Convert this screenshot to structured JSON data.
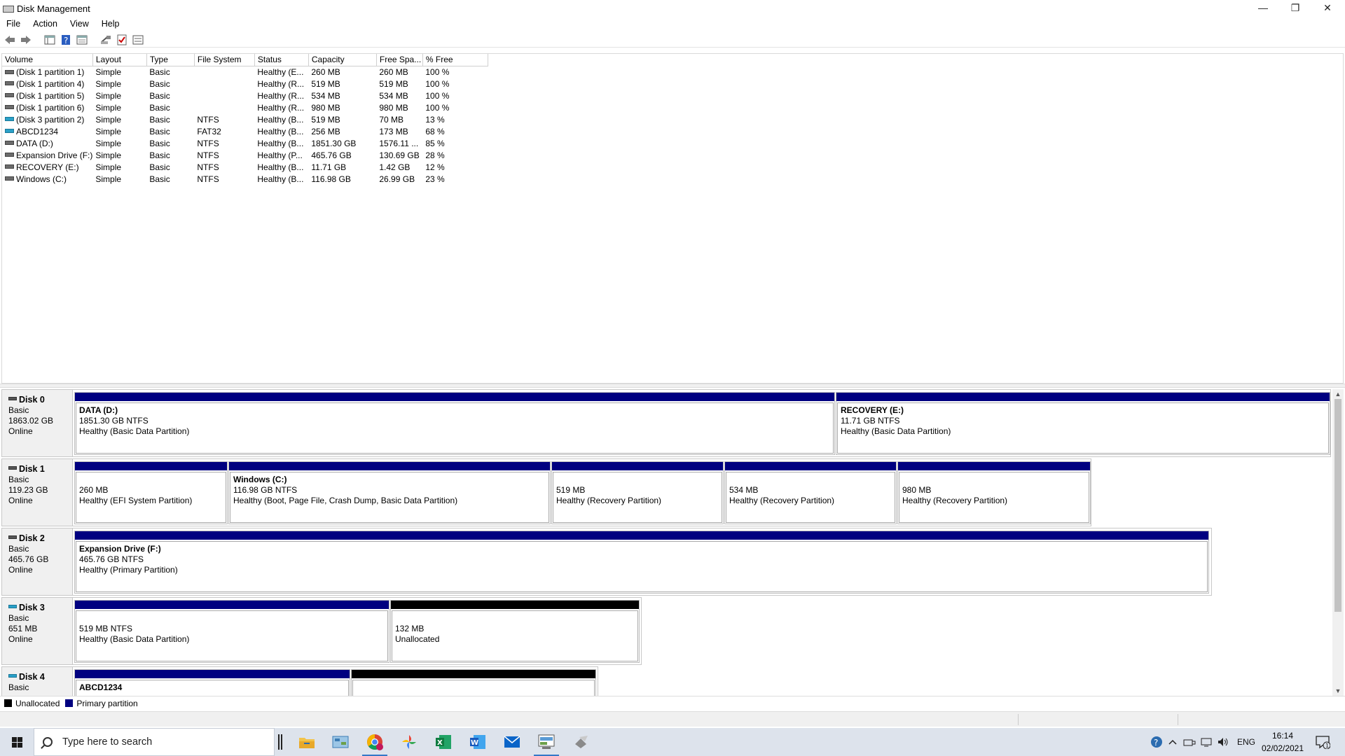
{
  "window": {
    "title": "Disk Management",
    "controls": {
      "minimize": "—",
      "restore": "❐",
      "close": "✕"
    }
  },
  "menu": [
    "File",
    "Action",
    "View",
    "Help"
  ],
  "toolbar_icons": [
    "back-arrow-icon",
    "forward-arrow-icon",
    "console-tree-icon",
    "help-icon",
    "properties-icon",
    "connect-icon",
    "check-icon",
    "list-icon"
  ],
  "volume_table": {
    "columns": [
      "Volume",
      "Layout",
      "Type",
      "File System",
      "Status",
      "Capacity",
      "Free Spa...",
      "% Free"
    ],
    "rows": [
      {
        "volume": "(Disk 1 partition 1)",
        "layout": "Simple",
        "type": "Basic",
        "fs": "",
        "status": "Healthy (E...",
        "capacity": "260 MB",
        "free": "260 MB",
        "pct": "100 %",
        "usb": false
      },
      {
        "volume": "(Disk 1 partition 4)",
        "layout": "Simple",
        "type": "Basic",
        "fs": "",
        "status": "Healthy (R...",
        "capacity": "519 MB",
        "free": "519 MB",
        "pct": "100 %",
        "usb": false
      },
      {
        "volume": "(Disk 1 partition 5)",
        "layout": "Simple",
        "type": "Basic",
        "fs": "",
        "status": "Healthy (R...",
        "capacity": "534 MB",
        "free": "534 MB",
        "pct": "100 %",
        "usb": false
      },
      {
        "volume": "(Disk 1 partition 6)",
        "layout": "Simple",
        "type": "Basic",
        "fs": "",
        "status": "Healthy (R...",
        "capacity": "980 MB",
        "free": "980 MB",
        "pct": "100 %",
        "usb": false
      },
      {
        "volume": "(Disk 3 partition 2)",
        "layout": "Simple",
        "type": "Basic",
        "fs": "NTFS",
        "status": "Healthy (B...",
        "capacity": "519 MB",
        "free": "70 MB",
        "pct": "13 %",
        "usb": true
      },
      {
        "volume": "ABCD1234",
        "layout": "Simple",
        "type": "Basic",
        "fs": "FAT32",
        "status": "Healthy (B...",
        "capacity": "256 MB",
        "free": "173 MB",
        "pct": "68 %",
        "usb": true
      },
      {
        "volume": "DATA (D:)",
        "layout": "Simple",
        "type": "Basic",
        "fs": "NTFS",
        "status": "Healthy (B...",
        "capacity": "1851.30 GB",
        "free": "1576.11 ...",
        "pct": "85 %",
        "usb": false
      },
      {
        "volume": "Expansion Drive (F:)",
        "layout": "Simple",
        "type": "Basic",
        "fs": "NTFS",
        "status": "Healthy (P...",
        "capacity": "465.76 GB",
        "free": "130.69 GB",
        "pct": "28 %",
        "usb": false
      },
      {
        "volume": "RECOVERY (E:)",
        "layout": "Simple",
        "type": "Basic",
        "fs": "NTFS",
        "status": "Healthy (B...",
        "capacity": "11.71 GB",
        "free": "1.42 GB",
        "pct": "12 %",
        "usb": false
      },
      {
        "volume": "Windows (C:)",
        "layout": "Simple",
        "type": "Basic",
        "fs": "NTFS",
        "status": "Healthy (B...",
        "capacity": "116.98 GB",
        "free": "26.99 GB",
        "pct": "23 %",
        "usb": false
      }
    ]
  },
  "disks": [
    {
      "name": "Disk 0",
      "type": "Basic",
      "size": "1863.02 GB",
      "status": "Online",
      "usb": false,
      "partitions": [
        {
          "title": "DATA  (D:)",
          "size": "1851.30 GB NTFS",
          "status": "Healthy (Basic Data Partition)",
          "unallocated": false
        },
        {
          "title": "RECOVERY  (E:)",
          "size": "11.71 GB NTFS",
          "status": "Healthy (Basic Data Partition)",
          "unallocated": false
        }
      ]
    },
    {
      "name": "Disk 1",
      "type": "Basic",
      "size": "119.23 GB",
      "status": "Online",
      "usb": false,
      "partitions": [
        {
          "title": "",
          "size": "260 MB",
          "status": "Healthy (EFI System Partition)",
          "unallocated": false
        },
        {
          "title": "Windows  (C:)",
          "size": "116.98 GB NTFS",
          "status": "Healthy (Boot, Page File, Crash Dump, Basic Data Partition)",
          "unallocated": false
        },
        {
          "title": "",
          "size": "519 MB",
          "status": "Healthy (Recovery Partition)",
          "unallocated": false
        },
        {
          "title": "",
          "size": "534 MB",
          "status": "Healthy (Recovery Partition)",
          "unallocated": false
        },
        {
          "title": "",
          "size": "980 MB",
          "status": "Healthy (Recovery Partition)",
          "unallocated": false
        }
      ]
    },
    {
      "name": "Disk 2",
      "type": "Basic",
      "size": "465.76 GB",
      "status": "Online",
      "usb": false,
      "partitions": [
        {
          "title": "Expansion Drive  (F:)",
          "size": "465.76 GB NTFS",
          "status": "Healthy (Primary Partition)",
          "unallocated": false
        }
      ]
    },
    {
      "name": "Disk 3",
      "type": "Basic",
      "size": "651 MB",
      "status": "Online",
      "usb": true,
      "partitions": [
        {
          "title": "",
          "size": "519 MB NTFS",
          "status": "Healthy (Basic Data Partition)",
          "unallocated": false
        },
        {
          "title": "",
          "size": "132 MB",
          "status": "Unallocated",
          "unallocated": true
        }
      ]
    },
    {
      "name": "Disk 4",
      "type": "Basic",
      "size": "",
      "status": "",
      "usb": true,
      "partitions": [
        {
          "title": "ABCD1234",
          "size": "",
          "status": "",
          "unallocated": false
        },
        {
          "title": "",
          "size": "",
          "status": "",
          "unallocated": true
        }
      ]
    }
  ],
  "legend": [
    {
      "label": "Unallocated",
      "color": "#000000"
    },
    {
      "label": "Primary partition",
      "color": "#000080"
    }
  ],
  "taskbar": {
    "search_placeholder": "Type here to search",
    "apps": [
      "task-view-icon",
      "file-explorer-icon",
      "control-panel-icon",
      "chrome-icon",
      "photos-icon",
      "excel-icon",
      "word-icon",
      "mail-icon",
      "disk-management-icon",
      "network-icon"
    ],
    "tray": {
      "language": "ENG",
      "time": "16:14",
      "date": "02/02/2021",
      "notifications": "1"
    }
  }
}
